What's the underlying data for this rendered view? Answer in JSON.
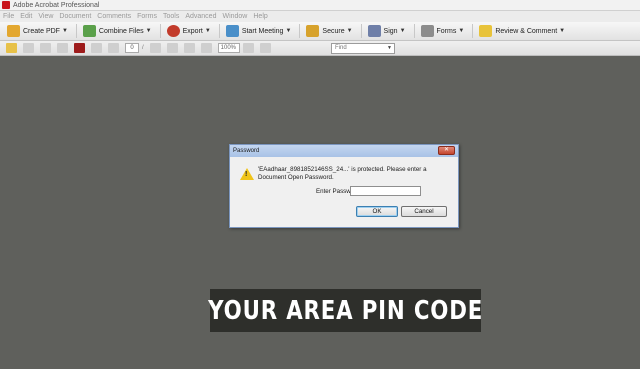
{
  "window": {
    "title": "Adobe Acrobat Professional"
  },
  "menu": [
    "File",
    "Edit",
    "View",
    "Document",
    "Comments",
    "Forms",
    "Tools",
    "Advanced",
    "Window",
    "Help"
  ],
  "toolbar": {
    "create_pdf": "Create PDF",
    "combine_files": "Combine Files",
    "export": "Export",
    "start_meeting": "Start Meeting",
    "secure": "Secure",
    "sign": "Sign",
    "forms": "Forms",
    "review_comment": "Review & Comment"
  },
  "nav": {
    "page_number": "0",
    "zoom": "100%",
    "find_placeholder": "Find"
  },
  "dialog": {
    "title": "Password",
    "message": "'EAadhaar_8981852146SS_24...' is protected. Please enter a Document Open Password.",
    "password_label": "Enter Password:",
    "password_value": "",
    "ok": "OK",
    "cancel": "Cancel",
    "close_glyph": "✕"
  },
  "caption": {
    "text": "YOUR AREA PIN CODE"
  },
  "colors": {
    "workspace": "#5f605c",
    "caption_bg": "#2e2f2b",
    "warning": "#f0c419"
  }
}
